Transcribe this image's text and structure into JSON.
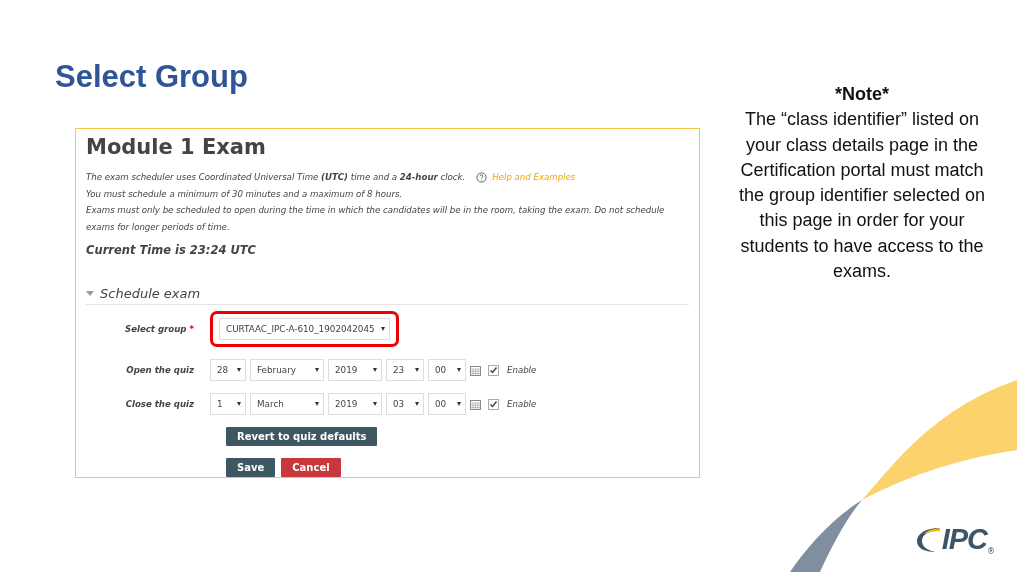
{
  "slide": {
    "title": "Select Group"
  },
  "exam": {
    "title": "Module 1 Exam",
    "intro": [
      "The exam scheduler uses Coordinated Universal Time **(UTC)** time and a **24-hour** clock.",
      "You must schedule a minimum of 30 minutes and a maximum of 8 hours.",
      "Exams must only be scheduled to open during the time in which the candidates will be in the room, taking the exam. Do not schedule exams for longer periods of time."
    ],
    "help_link": "Help and Examples",
    "current_time": "Current Time is 23:24 UTC",
    "section": {
      "label": "Schedule exam",
      "expanded": true
    },
    "group": {
      "label": "Select group",
      "required_mark": "*",
      "value": "CURTAAC_IPC-A-610_1902042045",
      "highlighted": true
    },
    "dates": [
      {
        "label": "Open the quiz",
        "fields": [
          "28",
          "February",
          "2019",
          "23",
          "00"
        ],
        "enabled": true,
        "enable_label": "Enable"
      },
      {
        "label": "Close the quiz",
        "fields": [
          "1",
          "March",
          "2019",
          "03",
          "00"
        ],
        "enabled": true,
        "enable_label": "Enable"
      }
    ],
    "button_rows": [
      [
        {
          "label": "Revert to quiz defaults",
          "kind": "secondary"
        }
      ],
      [
        {
          "label": "Save",
          "kind": "primary"
        },
        {
          "label": "Cancel",
          "kind": "danger"
        }
      ]
    ]
  },
  "note": {
    "heading": "*Note*",
    "text": "The “class identifier” listed on your class details page in the Certification portal must match the group identifier selected on this page in order for your students to have access to the exams."
  },
  "logo": {
    "text": "IPC",
    "mark": "®"
  }
}
